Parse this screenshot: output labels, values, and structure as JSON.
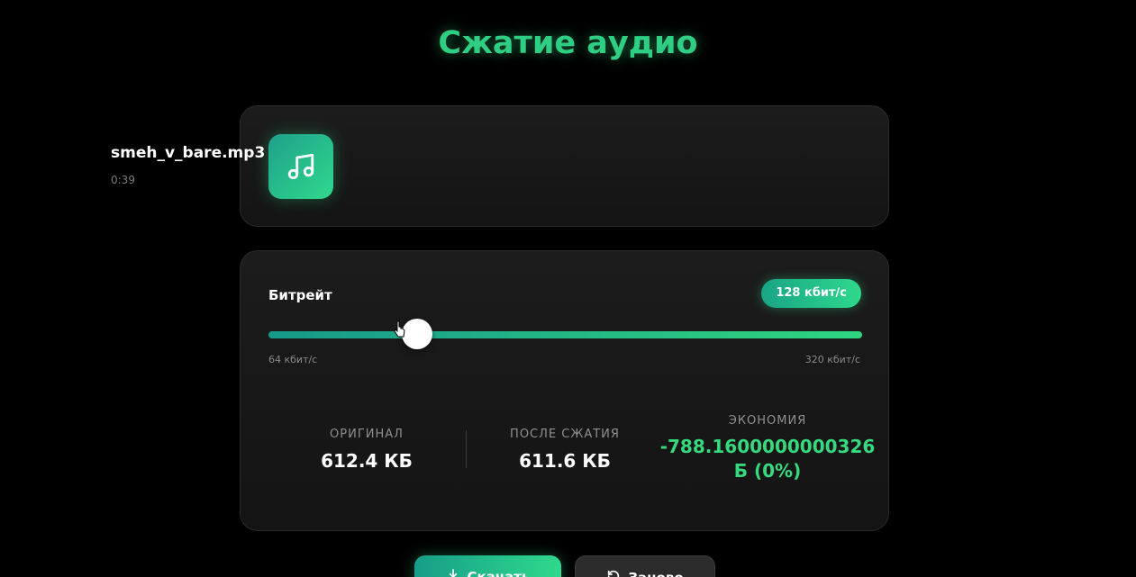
{
  "page": {
    "title": "Сжатие аудио"
  },
  "file": {
    "icon": "music-note-icon",
    "name": "smeh_v_bare.mp3",
    "duration": "0:39"
  },
  "bitrate": {
    "label": "Битрейт",
    "badge": "128 кбит/с",
    "min_label": "64 кбит/с",
    "max_label": "320 кбит/с",
    "value_kbps": 128,
    "min_kbps": 64,
    "max_kbps": 320
  },
  "stats": {
    "original_label": "ОРИГИНАЛ",
    "original_value": "612.4 КБ",
    "after_label": "ПОСЛЕ СЖАТИЯ",
    "after_value": "611.6 КБ",
    "savings_label": "ЭКОНОМИЯ",
    "savings_value": "-788.1600000000326 Б (0%)"
  },
  "actions": {
    "download_label": "Скачать",
    "back_label": "Заново",
    "download_icon": "download-icon",
    "back_icon": "refresh-icon"
  },
  "colors": {
    "accent": "#2fcf83",
    "accent_dark": "#169e88",
    "background": "#000000",
    "card": "#1a1a1a"
  }
}
